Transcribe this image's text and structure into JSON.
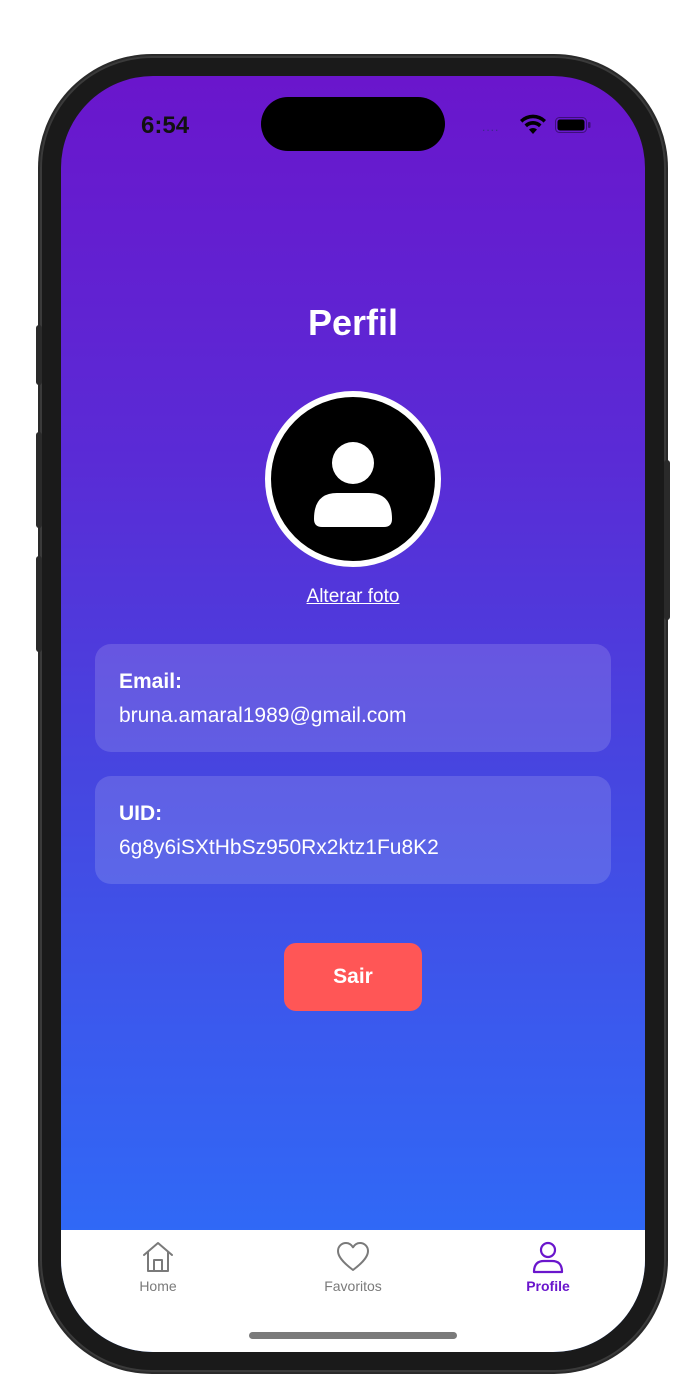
{
  "status_bar": {
    "time": "6:54",
    "signal_dots": "....",
    "wifi_icon": "wifi-icon",
    "battery_icon": "battery-icon"
  },
  "profile": {
    "title": "Perfil",
    "avatar_icon": "person-icon",
    "change_photo_label": "Alterar foto",
    "email_label": "Email:",
    "email_value": "bruna.amaral1989@gmail.com",
    "uid_label": "UID:",
    "uid_value": "6g8y6iSXtHbSz950Rx2ktz1Fu8K2",
    "logout_label": "Sair"
  },
  "tabbar": {
    "tabs": [
      {
        "label": "Home",
        "icon": "home-icon",
        "active": false
      },
      {
        "label": "Favoritos",
        "icon": "heart-icon",
        "active": false
      },
      {
        "label": "Profile",
        "icon": "person-icon",
        "active": true
      }
    ]
  },
  "colors": {
    "gradient_top": "#6a16cc",
    "gradient_bottom": "#2a72fb",
    "logout_button": "#ff5656",
    "active_tab": "#6a16cc",
    "inactive_tab": "#7a7a7a"
  }
}
